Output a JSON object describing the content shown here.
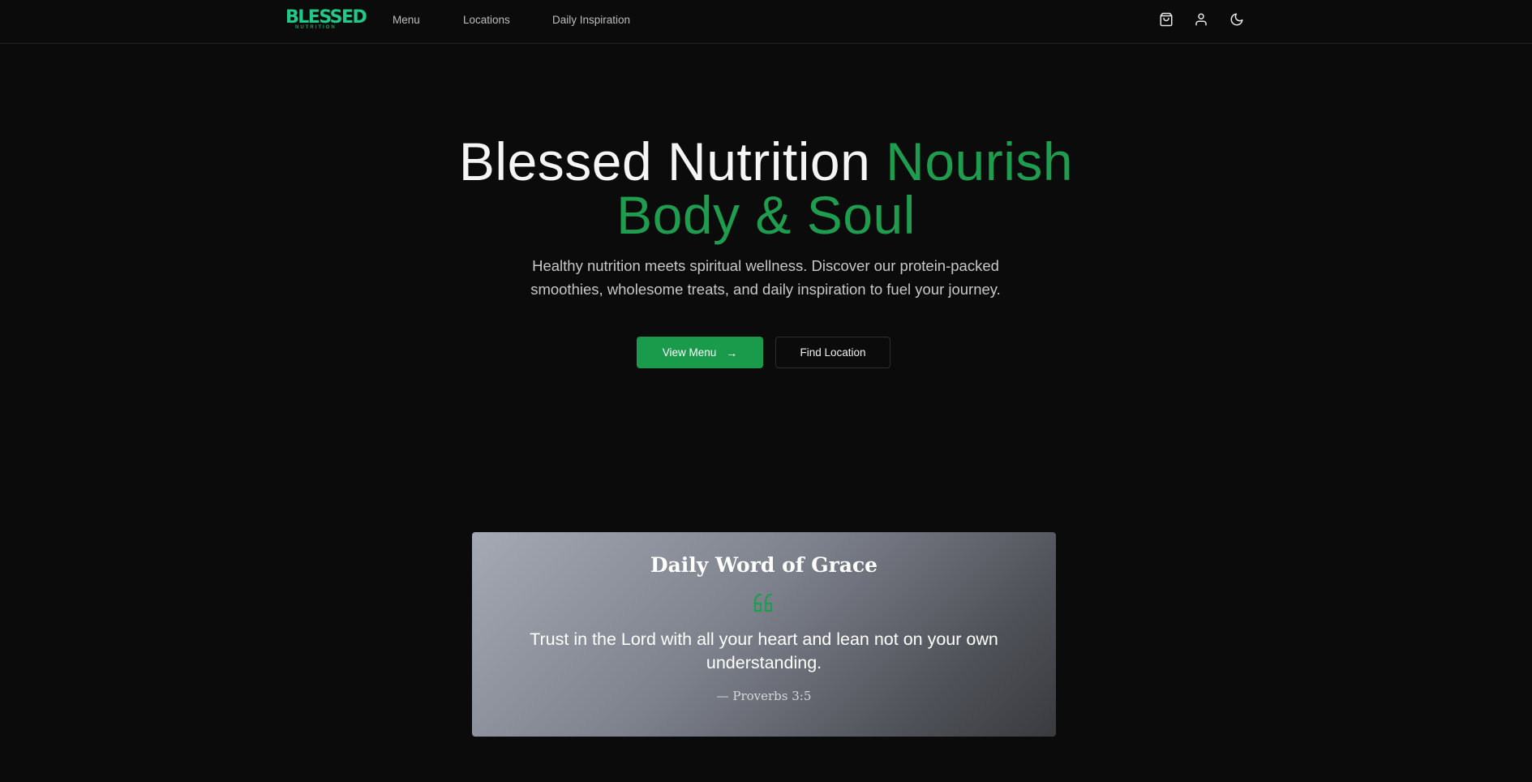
{
  "brand": {
    "logo_text": "BLESSED",
    "logo_subtext": "NUTRITION",
    "accent_color": "#1fc98a",
    "primary_green": "#1a9a4b"
  },
  "nav": {
    "links": [
      {
        "label": "Menu"
      },
      {
        "label": "Locations"
      },
      {
        "label": "Daily Inspiration"
      }
    ],
    "icons": [
      "shopping-bag-icon",
      "user-icon",
      "moon-icon"
    ]
  },
  "hero": {
    "title_white": "Blessed Nutrition",
    "title_green_1": "Nourish",
    "title_green_2": "Body & Soul",
    "subtitle": "Healthy nutrition meets spiritual wellness. Discover our protein-packed smoothies, wholesome treats, and daily inspiration to fuel your journey.",
    "primary_button": "View Menu",
    "primary_button_icon": "arrow-right-icon",
    "secondary_button": "Find Location"
  },
  "daily_word": {
    "title": "Daily Word of Grace",
    "quote_icon": "quote-icon",
    "verse": "Trust in the Lord with all your heart and lean not on your own understanding.",
    "reference": "— Proverbs 3:5"
  }
}
